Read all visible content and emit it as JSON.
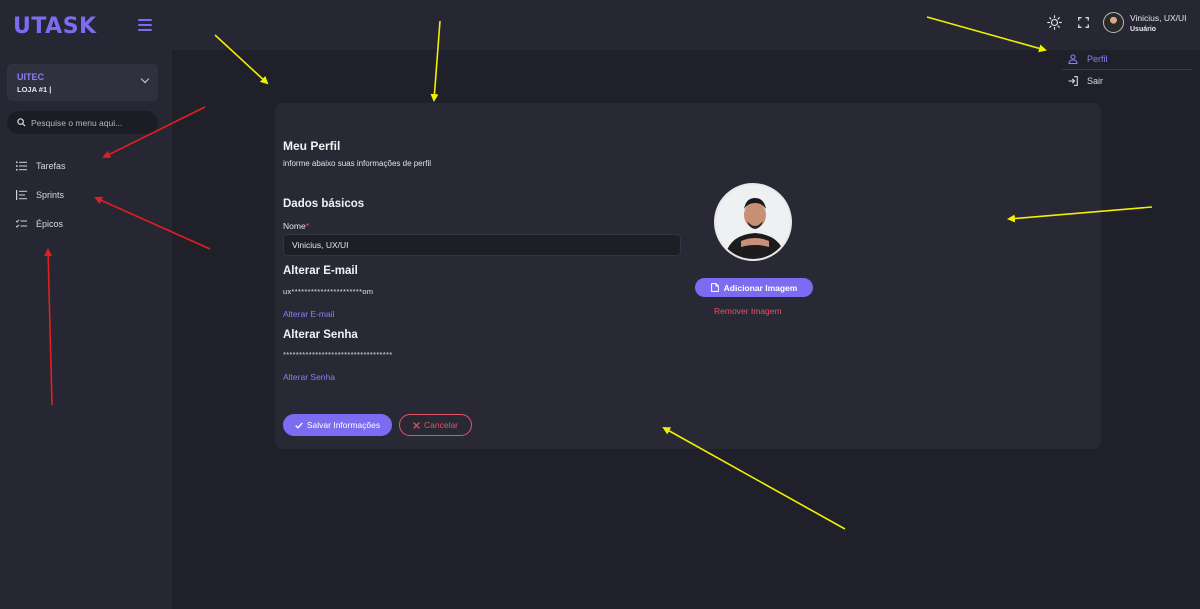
{
  "app": {
    "logo_u": "U",
    "logo_rest": "TASK"
  },
  "store": {
    "name": "UITEC",
    "sub": "LOJA #1 |"
  },
  "search": {
    "placeholder": "Pesquise o menu aqui..."
  },
  "sidebar": {
    "items": [
      {
        "label": "Tarefas",
        "icon": "list-icon"
      },
      {
        "label": "Sprints",
        "icon": "sprint-list-icon"
      },
      {
        "label": "Épicos",
        "icon": "checklist-icon"
      }
    ]
  },
  "header": {
    "user_name": "Vinicius, UX/UI",
    "user_role": "Usuário",
    "icons": [
      "sun-icon",
      "fullscreen-icon",
      "avatar"
    ]
  },
  "dropdown": {
    "items": [
      {
        "label": "Perfil",
        "icon": "user-icon"
      },
      {
        "label": "Sair",
        "icon": "logout-icon"
      }
    ]
  },
  "profile": {
    "title": "Meu Perfil",
    "subtitle": "informe abaixo suas informações de perfil",
    "basic_section": "Dados básicos",
    "name_label": "Nome",
    "name_required": "*",
    "name_value": "Vinicius, UX/UI",
    "email_section": "Alterar E-mail",
    "email_masked": "ux**********************om",
    "email_link": "Alterar E-mail",
    "password_section": "Alterar Senha",
    "password_masked": "**********************************",
    "password_link": "Alterar Senha",
    "add_image": "Adicionar Imagem",
    "remove_image": "Remover Imagem",
    "save": "Salvar Informações",
    "cancel": "Cancelar"
  },
  "colors": {
    "accent": "#7c6cf2",
    "danger": "#e25467",
    "background": "#1f2029",
    "panel": "#262732",
    "card": "#282934",
    "annotation_yellow": "#f0f000",
    "annotation_red": "#e02020"
  }
}
